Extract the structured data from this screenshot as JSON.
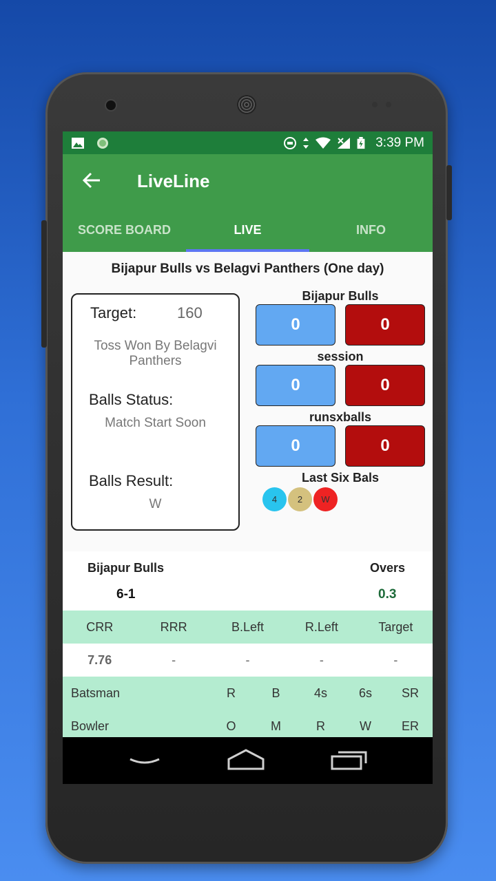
{
  "status_bar": {
    "time": "3:39 PM"
  },
  "app_bar": {
    "title": "LiveLine",
    "back_icon": "arrow-left-icon"
  },
  "tabs": [
    {
      "label": "SCORE BOARD"
    },
    {
      "label": "LIVE"
    },
    {
      "label": "INFO"
    }
  ],
  "match_title": "Bijapur Bulls vs Belagvi Panthers (One day)",
  "info_card": {
    "target_label": "Target:",
    "target_value": "160",
    "toss": "Toss Won By Belagvi Panthers",
    "balls_status_label": "Balls Status:",
    "balls_status_value": "Match Start Soon",
    "balls_result_label": "Balls Result:",
    "balls_result_value": "W"
  },
  "rates": [
    {
      "label": "Bijapur Bulls",
      "left": "0",
      "right": "0"
    },
    {
      "label": "session",
      "left": "0",
      "right": "0"
    },
    {
      "label": "runsxballs",
      "left": "0",
      "right": "0"
    }
  ],
  "last_six": {
    "label": "Last Six Bals",
    "balls": [
      {
        "value": "4",
        "color": "#29c4ee"
      },
      {
        "value": "2",
        "color": "#d4c17e"
      },
      {
        "value": "W",
        "color": "#ee2323"
      }
    ]
  },
  "score": {
    "team": "Bijapur Bulls",
    "score": "6-1",
    "overs_label": "Overs",
    "overs_value": "0.3"
  },
  "stats": {
    "headers": [
      "CRR",
      "RRR",
      "B.Left",
      "R.Left",
      "Target"
    ],
    "values": [
      "7.76",
      "-",
      "-",
      "-",
      "-"
    ]
  },
  "batsman": {
    "label": "Batsman",
    "cols": [
      "R",
      "B",
      "4s",
      "6s",
      "SR"
    ]
  },
  "bowler": {
    "label": "Bowler",
    "cols": [
      "O",
      "M",
      "R",
      "W",
      "ER"
    ]
  },
  "colors": {
    "status_bar": "#1e7e3a",
    "app_bar": "#3f9b4a",
    "tab_indicator": "#5d76f2",
    "blue_box": "#62a8f2",
    "red_box": "#b30d0d",
    "stats_bg": "#b4ecd0"
  }
}
